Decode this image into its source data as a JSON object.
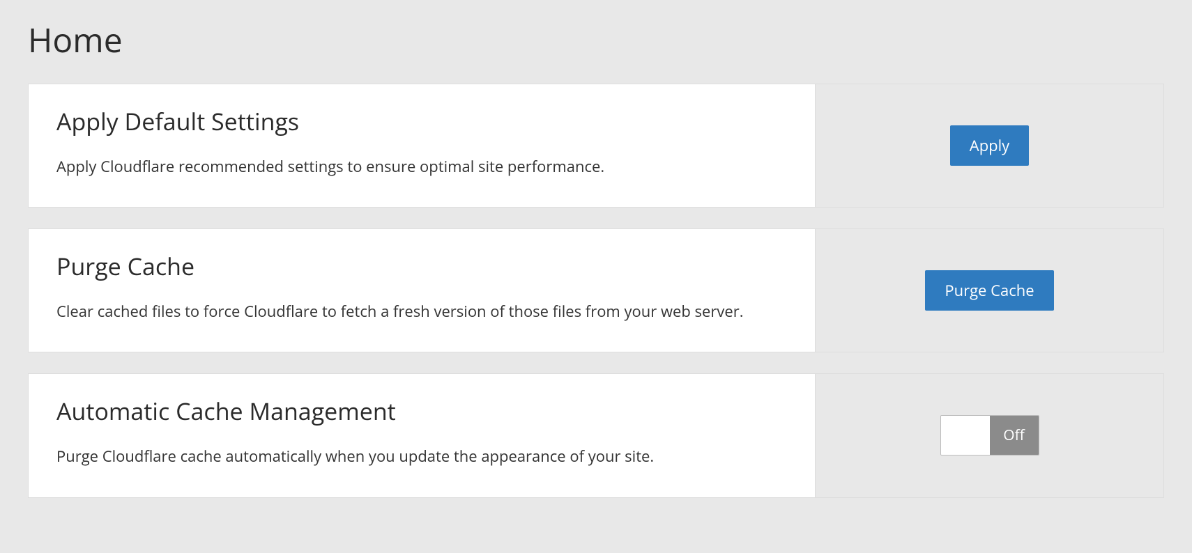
{
  "page": {
    "title": "Home"
  },
  "cards": {
    "apply_default": {
      "heading": "Apply Default Settings",
      "description": "Apply Cloudflare recommended settings to ensure optimal site performance.",
      "button_label": "Apply"
    },
    "purge_cache": {
      "heading": "Purge Cache",
      "description": "Clear cached files to force Cloudflare to fetch a fresh version of those files from your web server.",
      "button_label": "Purge Cache"
    },
    "auto_cache": {
      "heading": "Automatic Cache Management",
      "description": "Purge Cloudflare cache automatically when you update the appearance of your site.",
      "toggle_state": "Off"
    }
  }
}
